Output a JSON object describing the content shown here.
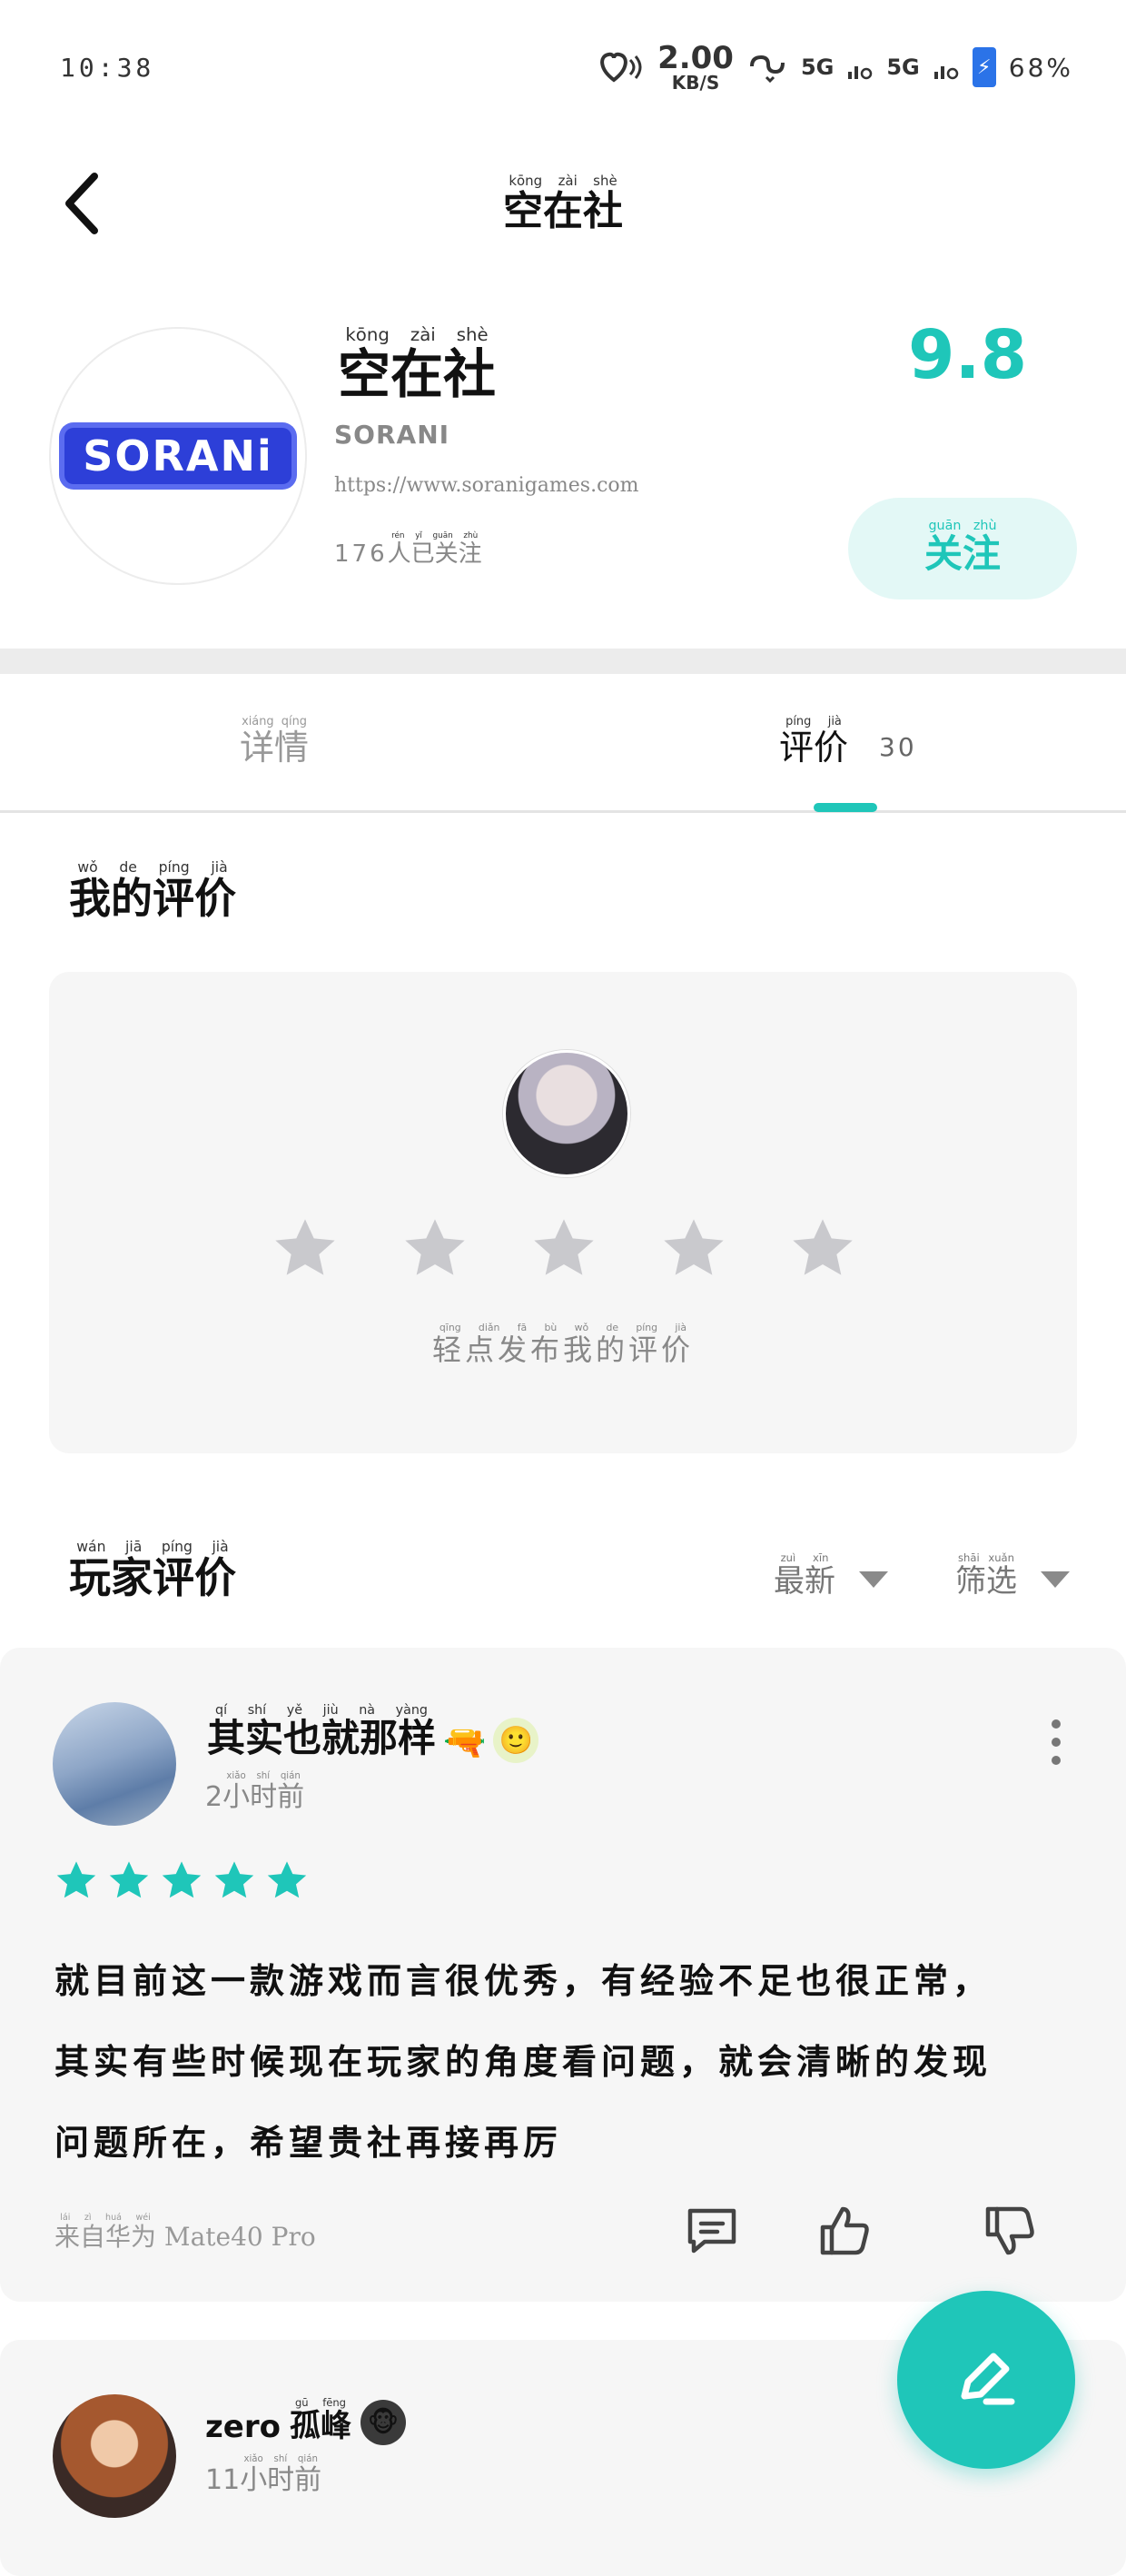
{
  "status_bar": {
    "time": "10:38",
    "net_speed_value": "2.00",
    "net_speed_unit": "KB/S",
    "signal_1": "5G",
    "signal_2": "5G",
    "battery": "68%"
  },
  "header": {
    "title": "空在社",
    "title_pinyin": "kōng zài shè",
    "back_icon": "chevron-left-icon"
  },
  "publisher": {
    "name": "空在社",
    "name_pinyin": "kōng zài shè",
    "logo_text": "SORANi",
    "latin_name": "SORANI",
    "url": "https://www.soranigames.com",
    "follower_count": "176",
    "follower_suffix": "人已关注",
    "follower_suffix_pinyin": "rén yǐ guān zhù",
    "score": "9.8",
    "follow_label": "关注",
    "follow_pinyin": "guān zhù"
  },
  "tabs": {
    "details_label": "详情",
    "details_pinyin": "xiáng qíng",
    "reviews_label": "评价",
    "reviews_pinyin": "píng jià",
    "reviews_count": "30"
  },
  "my_review": {
    "heading": "我的评价",
    "heading_pinyin": "wǒ de píng jià",
    "hint": "轻点发布我的评价",
    "hint_pinyin": "qīng diǎn fā bù wǒ de píng jià",
    "star_count": 5
  },
  "player_reviews": {
    "heading": "玩家评价",
    "heading_pinyin": "wán jiā píng jià",
    "sort_label": "最新",
    "sort_pinyin": "zuì xīn",
    "filter_label": "筛选",
    "filter_pinyin": "shāi xuǎn"
  },
  "reviews": [
    {
      "user": "其实也就那样",
      "user_pinyin": "qí shí yě jiù nà yàng",
      "time_num": "2",
      "time_suffix": "小时前",
      "time_pinyin": "xiǎo shí qián",
      "rating": 5,
      "text_line_1": "就目前这一款游戏而言很优秀，有经验不足也很正常，",
      "text_line_2": "其实有些时候现在玩家的角度看问题，就会清晰的发现",
      "text_line_3": "问题所在，希望贵社再接再厉",
      "device_prefix": "来自华为",
      "device_prefix_pinyin": "lái zì huá wéi",
      "device_model": "Mate40 Pro",
      "emoji_1": "🔫",
      "emoji_2": "🙂"
    },
    {
      "user_latin": "zero",
      "user": "孤峰",
      "user_pinyin": "gū fēng",
      "time_num": "11",
      "time_suffix": "小时前",
      "time_pinyin": "xiǎo shí qián",
      "emoji_1": "🐵"
    }
  ],
  "colors": {
    "accent": "#1fc6b9",
    "accent_light": "#e3f8f6",
    "card_bg": "#f6f6f6",
    "star_empty": "#c9c9cd"
  },
  "icons": [
    "chevron-left-icon",
    "star-icon",
    "chevron-down-icon",
    "more-vertical-icon",
    "comment-icon",
    "thumbs-up-icon",
    "thumbs-down-icon",
    "pen-icon"
  ]
}
